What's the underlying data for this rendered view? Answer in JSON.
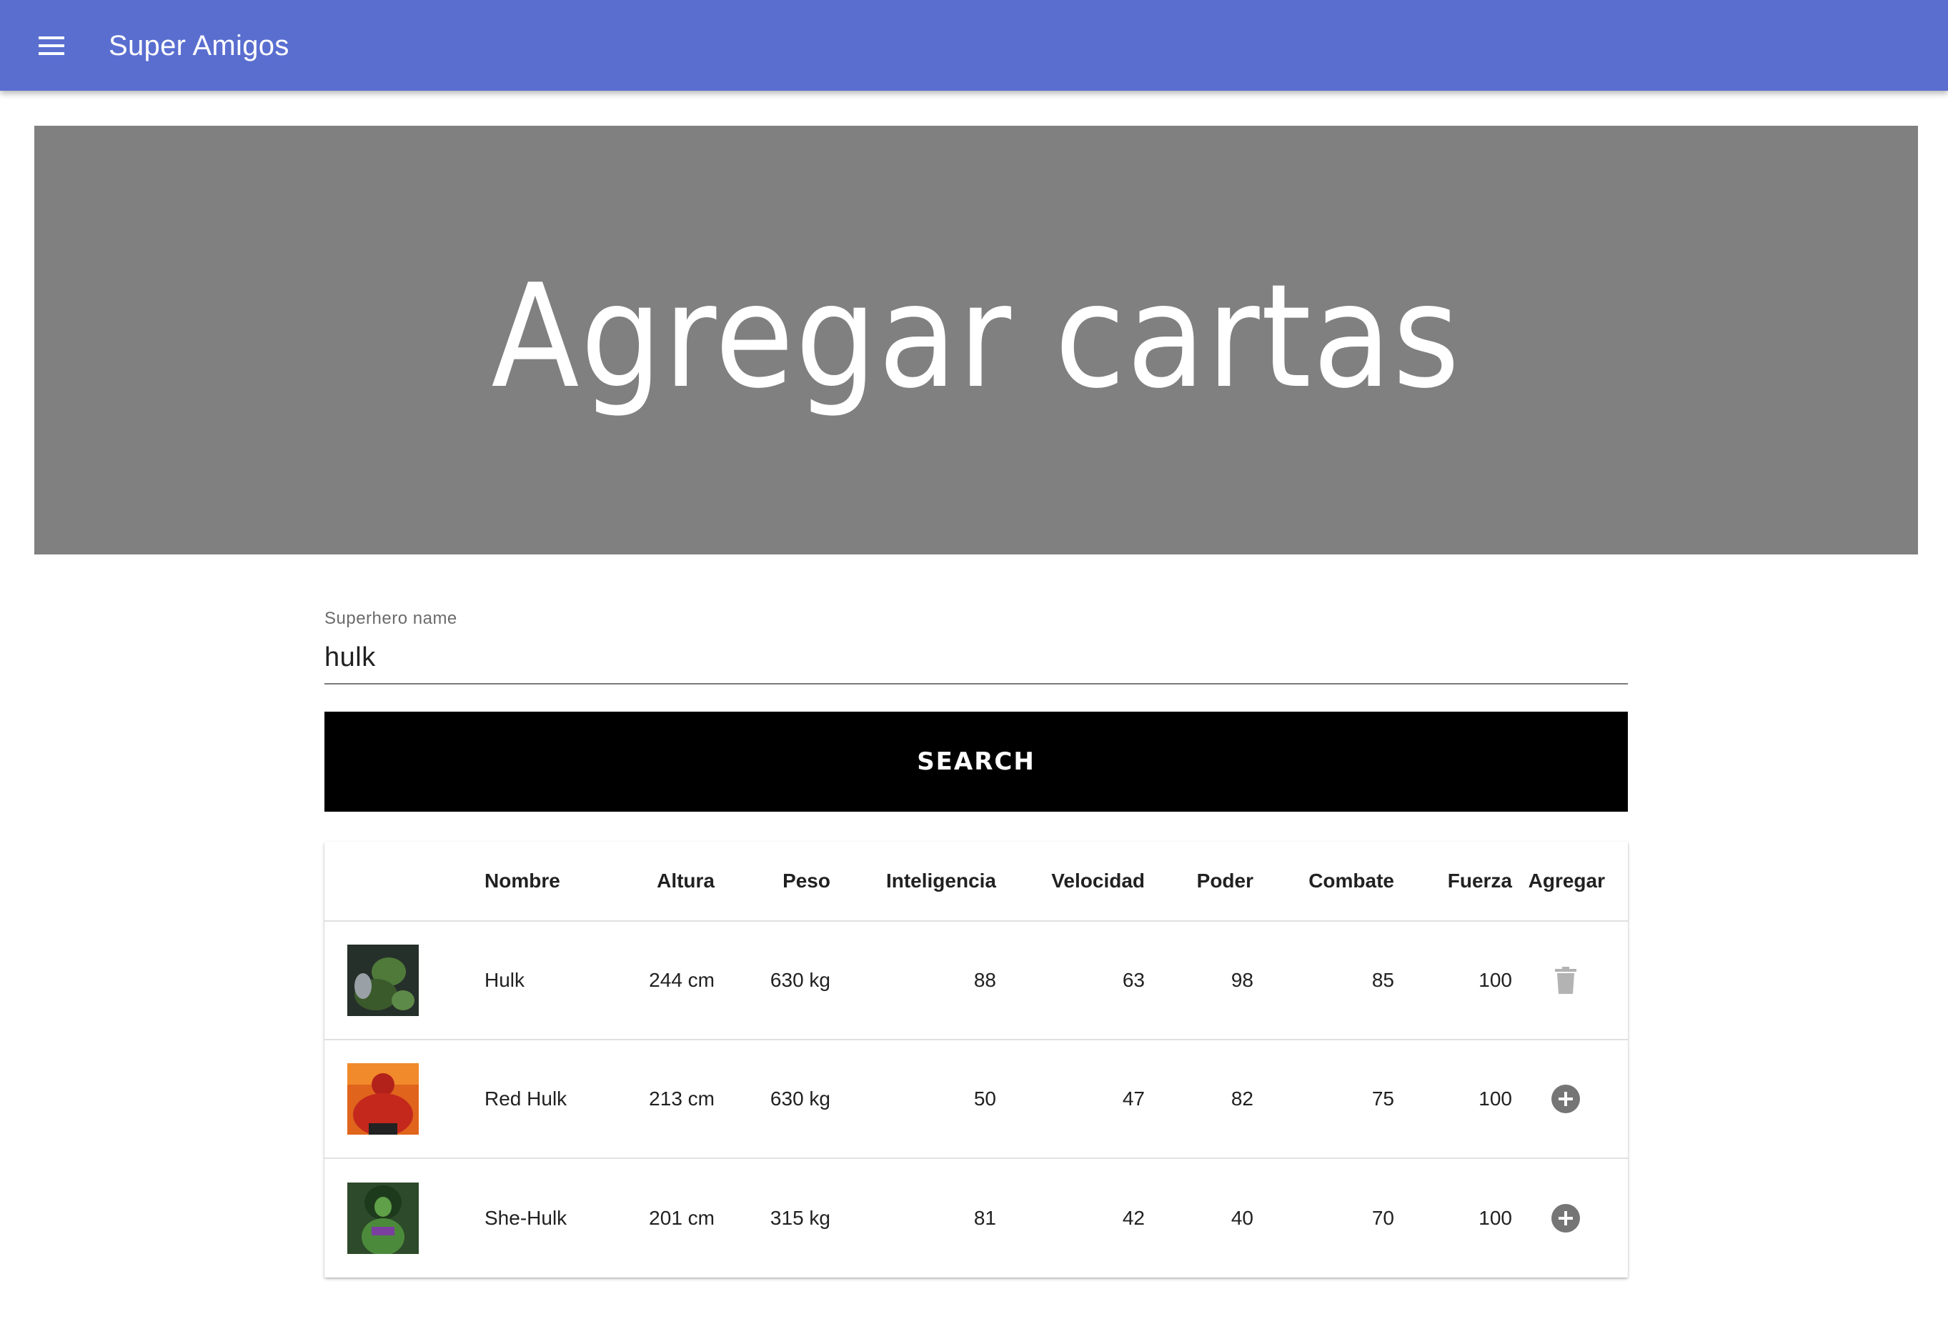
{
  "app": {
    "title": "Super Amigos"
  },
  "hero": {
    "title": "Agregar cartas"
  },
  "search": {
    "label": "Superhero name",
    "value": "hulk",
    "button_label": "SEARCH"
  },
  "table": {
    "headers": {
      "image": "",
      "name": "Nombre",
      "height": "Altura",
      "weight": "Peso",
      "intelligence": "Inteligencia",
      "speed": "Velocidad",
      "power": "Poder",
      "combat": "Combate",
      "strength": "Fuerza",
      "add": "Agregar"
    },
    "rows": [
      {
        "name": "Hulk",
        "height": "244 cm",
        "weight": "630 kg",
        "intelligence": "88",
        "speed": "63",
        "power": "98",
        "combat": "85",
        "strength": "100",
        "action_icon": "trash-icon",
        "thumb_color": "#3a4a3a"
      },
      {
        "name": "Red Hulk",
        "height": "213 cm",
        "weight": "630 kg",
        "intelligence": "50",
        "speed": "47",
        "power": "82",
        "combat": "75",
        "strength": "100",
        "action_icon": "add-circle-icon",
        "thumb_color": "#c23a1e"
      },
      {
        "name": "She-Hulk",
        "height": "201 cm",
        "weight": "315 kg",
        "intelligence": "81",
        "speed": "42",
        "power": "40",
        "combat": "70",
        "strength": "100",
        "action_icon": "add-circle-icon",
        "thumb_color": "#3f7a35"
      }
    ]
  },
  "colors": {
    "appbar": "#5a6ed0",
    "hero_bg": "#808080",
    "button_bg": "#000000",
    "icon_gray": "#757575",
    "trash_gray": "#b3b3b3"
  }
}
